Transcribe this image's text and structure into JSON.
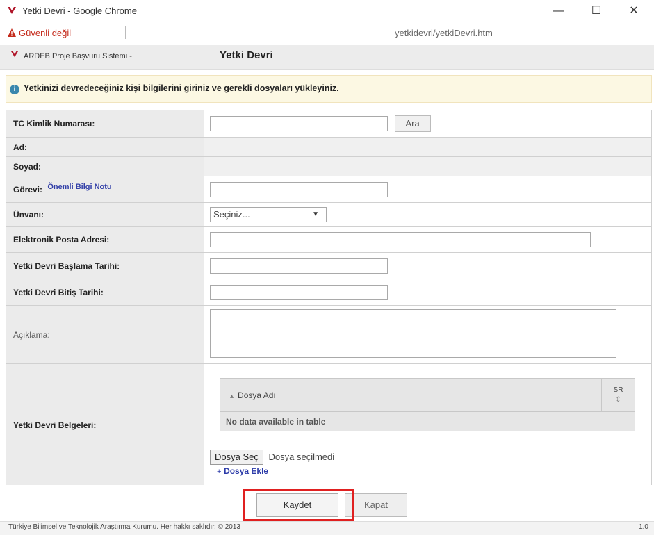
{
  "window": {
    "title": "Yetki Devri - Google Chrome",
    "minimize": "—",
    "maximize": "☐",
    "close": "✕"
  },
  "addressbar": {
    "security": "Güvenli değil",
    "url": "yetkidevri/yetkiDevri.htm"
  },
  "app": {
    "name": "ARDEB Proje Başvuru Sistemi -",
    "page": "Yetki Devri"
  },
  "info": {
    "icon": "i",
    "text": "Yetkinizi devredeceğiniz kişi bilgilerini giriniz ve gerekli dosyaları yükleyiniz."
  },
  "form": {
    "tc_label": "TC Kimlik Numarası:",
    "tc_value": "",
    "search_button": "Ara",
    "ad_label": "Ad:",
    "ad_value": "",
    "soyad_label": "Soyad:",
    "soyad_value": "",
    "gorev_label": "Görevi:",
    "gorev_link": "Önemli Bilgi Notu",
    "gorev_value": "",
    "unvan_label": "Ünvanı:",
    "unvan_selected": "Seçiniz...",
    "email_label": "Elektronik Posta Adresi:",
    "email_value": "",
    "start_label": "Yetki Devri Başlama Tarihi:",
    "start_value": "",
    "end_label": "Yetki Devri Bitiş Tarihi:",
    "end_value": "",
    "desc_label": "Açıklama:",
    "desc_value": "",
    "docs_label": "Yetki Devri Belgeleri:"
  },
  "files_table": {
    "col_name": "Dosya Adı",
    "col_sr": "SR",
    "sort_icon": "⇕",
    "empty": "No data available in table"
  },
  "file_input": {
    "button": "Dosya Seç",
    "status": "Dosya seçilmedi",
    "add_link": "Dosya Ekle"
  },
  "actions": {
    "save": "Kaydet",
    "close": "Kapat"
  },
  "footer": {
    "text": "Türkiye Bilimsel ve Teknolojik Araştırma Kurumu. Her hakkı saklıdır. © 2013",
    "version": "1.0"
  },
  "colors": {
    "accent_red": "#c42b1c",
    "highlight_box": "#e02020",
    "link_blue": "#2b3aa8",
    "info_bg": "#fcf8e3"
  }
}
